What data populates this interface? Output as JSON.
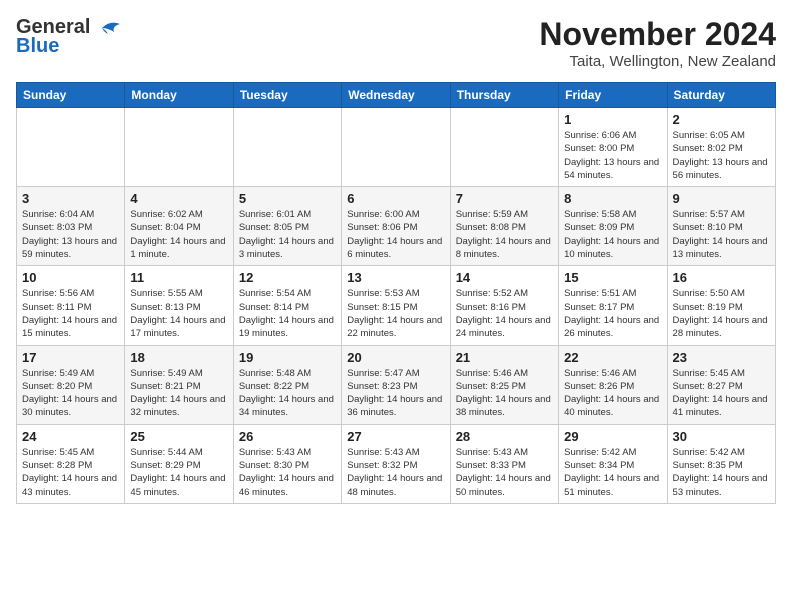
{
  "header": {
    "logo_general": "General",
    "logo_blue": "Blue",
    "month": "November 2024",
    "location": "Taita, Wellington, New Zealand"
  },
  "weekdays": [
    "Sunday",
    "Monday",
    "Tuesday",
    "Wednesday",
    "Thursday",
    "Friday",
    "Saturday"
  ],
  "weeks": [
    [
      {
        "day": "",
        "info": ""
      },
      {
        "day": "",
        "info": ""
      },
      {
        "day": "",
        "info": ""
      },
      {
        "day": "",
        "info": ""
      },
      {
        "day": "",
        "info": ""
      },
      {
        "day": "1",
        "info": "Sunrise: 6:06 AM\nSunset: 8:00 PM\nDaylight: 13 hours and 54 minutes."
      },
      {
        "day": "2",
        "info": "Sunrise: 6:05 AM\nSunset: 8:02 PM\nDaylight: 13 hours and 56 minutes."
      }
    ],
    [
      {
        "day": "3",
        "info": "Sunrise: 6:04 AM\nSunset: 8:03 PM\nDaylight: 13 hours and 59 minutes."
      },
      {
        "day": "4",
        "info": "Sunrise: 6:02 AM\nSunset: 8:04 PM\nDaylight: 14 hours and 1 minute."
      },
      {
        "day": "5",
        "info": "Sunrise: 6:01 AM\nSunset: 8:05 PM\nDaylight: 14 hours and 3 minutes."
      },
      {
        "day": "6",
        "info": "Sunrise: 6:00 AM\nSunset: 8:06 PM\nDaylight: 14 hours and 6 minutes."
      },
      {
        "day": "7",
        "info": "Sunrise: 5:59 AM\nSunset: 8:08 PM\nDaylight: 14 hours and 8 minutes."
      },
      {
        "day": "8",
        "info": "Sunrise: 5:58 AM\nSunset: 8:09 PM\nDaylight: 14 hours and 10 minutes."
      },
      {
        "day": "9",
        "info": "Sunrise: 5:57 AM\nSunset: 8:10 PM\nDaylight: 14 hours and 13 minutes."
      }
    ],
    [
      {
        "day": "10",
        "info": "Sunrise: 5:56 AM\nSunset: 8:11 PM\nDaylight: 14 hours and 15 minutes."
      },
      {
        "day": "11",
        "info": "Sunrise: 5:55 AM\nSunset: 8:13 PM\nDaylight: 14 hours and 17 minutes."
      },
      {
        "day": "12",
        "info": "Sunrise: 5:54 AM\nSunset: 8:14 PM\nDaylight: 14 hours and 19 minutes."
      },
      {
        "day": "13",
        "info": "Sunrise: 5:53 AM\nSunset: 8:15 PM\nDaylight: 14 hours and 22 minutes."
      },
      {
        "day": "14",
        "info": "Sunrise: 5:52 AM\nSunset: 8:16 PM\nDaylight: 14 hours and 24 minutes."
      },
      {
        "day": "15",
        "info": "Sunrise: 5:51 AM\nSunset: 8:17 PM\nDaylight: 14 hours and 26 minutes."
      },
      {
        "day": "16",
        "info": "Sunrise: 5:50 AM\nSunset: 8:19 PM\nDaylight: 14 hours and 28 minutes."
      }
    ],
    [
      {
        "day": "17",
        "info": "Sunrise: 5:49 AM\nSunset: 8:20 PM\nDaylight: 14 hours and 30 minutes."
      },
      {
        "day": "18",
        "info": "Sunrise: 5:49 AM\nSunset: 8:21 PM\nDaylight: 14 hours and 32 minutes."
      },
      {
        "day": "19",
        "info": "Sunrise: 5:48 AM\nSunset: 8:22 PM\nDaylight: 14 hours and 34 minutes."
      },
      {
        "day": "20",
        "info": "Sunrise: 5:47 AM\nSunset: 8:23 PM\nDaylight: 14 hours and 36 minutes."
      },
      {
        "day": "21",
        "info": "Sunrise: 5:46 AM\nSunset: 8:25 PM\nDaylight: 14 hours and 38 minutes."
      },
      {
        "day": "22",
        "info": "Sunrise: 5:46 AM\nSunset: 8:26 PM\nDaylight: 14 hours and 40 minutes."
      },
      {
        "day": "23",
        "info": "Sunrise: 5:45 AM\nSunset: 8:27 PM\nDaylight: 14 hours and 41 minutes."
      }
    ],
    [
      {
        "day": "24",
        "info": "Sunrise: 5:45 AM\nSunset: 8:28 PM\nDaylight: 14 hours and 43 minutes."
      },
      {
        "day": "25",
        "info": "Sunrise: 5:44 AM\nSunset: 8:29 PM\nDaylight: 14 hours and 45 minutes."
      },
      {
        "day": "26",
        "info": "Sunrise: 5:43 AM\nSunset: 8:30 PM\nDaylight: 14 hours and 46 minutes."
      },
      {
        "day": "27",
        "info": "Sunrise: 5:43 AM\nSunset: 8:32 PM\nDaylight: 14 hours and 48 minutes."
      },
      {
        "day": "28",
        "info": "Sunrise: 5:43 AM\nSunset: 8:33 PM\nDaylight: 14 hours and 50 minutes."
      },
      {
        "day": "29",
        "info": "Sunrise: 5:42 AM\nSunset: 8:34 PM\nDaylight: 14 hours and 51 minutes."
      },
      {
        "day": "30",
        "info": "Sunrise: 5:42 AM\nSunset: 8:35 PM\nDaylight: 14 hours and 53 minutes."
      }
    ]
  ]
}
